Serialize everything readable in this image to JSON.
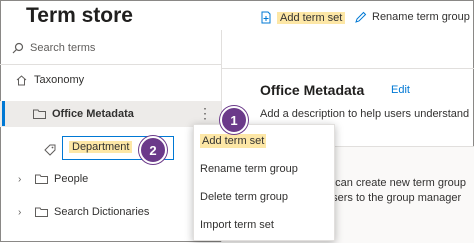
{
  "title": "Term store",
  "search": {
    "placeholder": "Search terms"
  },
  "nav": {
    "taxonomy": "Taxonomy",
    "group_selected": "Office Metadata",
    "new_term_set_value": "Department",
    "people": "People",
    "search_dictionaries": "Search Dictionaries"
  },
  "toolbar": {
    "add_term_set": "Add term set",
    "rename_group": "Rename term group"
  },
  "main": {
    "heading": "Office Metadata",
    "edit": "Edit",
    "description": "Add a description to help users understand",
    "panel_lines": [
      "rs",
      "o can create new term group",
      "users to the group manager",
      "e."
    ]
  },
  "menu": {
    "items": [
      "Add term set",
      "Rename term group",
      "Delete term group",
      "Import term set"
    ]
  },
  "badges": {
    "first": "1",
    "second": "2"
  },
  "colors": {
    "accent": "#0078d4",
    "highlight": "#fde7a6",
    "badge": "#6b3a8a"
  }
}
